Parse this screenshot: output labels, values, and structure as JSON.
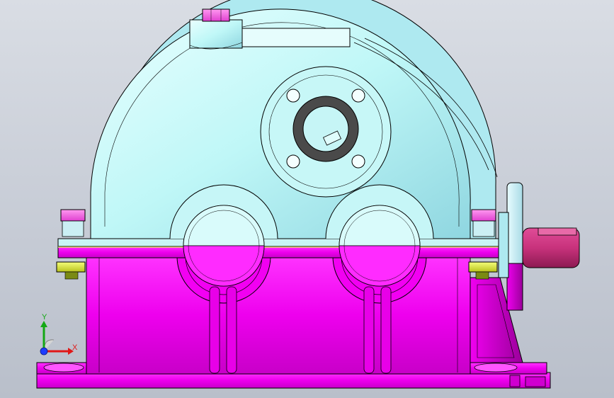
{
  "viewport": {
    "background_top": "#d9dde4",
    "background_bottom": "#b9bfca"
  },
  "model": {
    "upper_housing_color": "#bff7f7",
    "lower_housing_color": "#ff00ff",
    "bolt_head_color": "#ff66e6",
    "nut_color": "#e4f23a",
    "shaft_color": "#c8327c",
    "outline_color": "#000000"
  },
  "triad": {
    "x_label": "X",
    "y_label": "Y",
    "x_color": "#e01818",
    "y_color": "#14a814",
    "z_color": "#1e3cff"
  }
}
